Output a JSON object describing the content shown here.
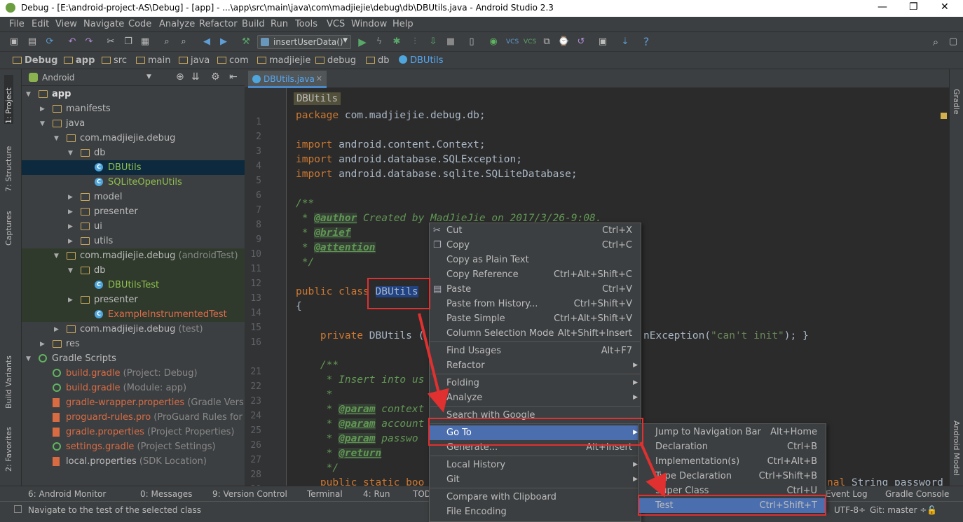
{
  "title": "Debug - [E:\\android-project-AS\\Debug] - [app] - ...\\app\\src\\main\\java\\com\\madjiejie\\debug\\db\\DBUtils.java - Android Studio 2.3",
  "menu": [
    "File",
    "Edit",
    "View",
    "Navigate",
    "Code",
    "Analyze",
    "Refactor",
    "Build",
    "Run",
    "Tools",
    "VCS",
    "Window",
    "Help"
  ],
  "run_config": "insertUserData()",
  "breadcrumb": [
    "Debug",
    "app",
    "src",
    "main",
    "java",
    "com",
    "madjiejie",
    "debug",
    "db",
    "DBUtils"
  ],
  "project_view": "Android",
  "left_tabs": [
    "1: Project",
    "7: Structure",
    "Captures",
    "Build Variants",
    "2: Favorites"
  ],
  "right_tabs": [
    "Gradle",
    "Android Model"
  ],
  "tree": [
    {
      "label": "app",
      "extra": ""
    },
    {
      "label": "manifests",
      "extra": ""
    },
    {
      "label": "java",
      "extra": ""
    },
    {
      "label": "com.madjiejie.debug",
      "extra": ""
    },
    {
      "label": "db",
      "extra": ""
    },
    {
      "label": "DBUtils",
      "extra": ""
    },
    {
      "label": "SQLiteOpenUtils",
      "extra": ""
    },
    {
      "label": "model",
      "extra": ""
    },
    {
      "label": "presenter",
      "extra": ""
    },
    {
      "label": "ui",
      "extra": ""
    },
    {
      "label": "utils",
      "extra": ""
    },
    {
      "label": "com.madjiejie.debug",
      "extra": "(androidTest)"
    },
    {
      "label": "db",
      "extra": ""
    },
    {
      "label": "DBUtilsTest",
      "extra": ""
    },
    {
      "label": "presenter",
      "extra": ""
    },
    {
      "label": "ExampleInstrumentedTest",
      "extra": ""
    },
    {
      "label": "com.madjiejie.debug",
      "extra": "(test)"
    },
    {
      "label": "res",
      "extra": ""
    },
    {
      "label": "Gradle Scripts",
      "extra": ""
    },
    {
      "label": "build.gradle",
      "extra": "(Project: Debug)"
    },
    {
      "label": "build.gradle",
      "extra": "(Module: app)"
    },
    {
      "label": "gradle-wrapper.properties",
      "extra": "(Gradle Version)"
    },
    {
      "label": "proguard-rules.pro",
      "extra": "(ProGuard Rules for app"
    },
    {
      "label": "gradle.properties",
      "extra": "(Project Properties)"
    },
    {
      "label": "settings.gradle",
      "extra": "(Project Settings)"
    },
    {
      "label": "local.properties",
      "extra": "(SDK Location)"
    }
  ],
  "editor_tab": "DBUtils.java",
  "editor_crumb": "DBUtils",
  "line_numbers": [
    "1",
    "2",
    "3",
    "4",
    "5",
    "6",
    "7",
    "8",
    "9",
    "10",
    "11",
    "12",
    "13",
    "14",
    "15",
    "16",
    "21",
    "22",
    "23",
    "24",
    "25",
    "26",
    "27",
    "28",
    "29"
  ],
  "code": {
    "l1a": "package ",
    "l1b": "com.madjiejie.debug.db;",
    "l3a": "import ",
    "l3b": "android.content.Context;",
    "l4a": "import ",
    "l4b": "android.database.SQLException;",
    "l5a": "import ",
    "l5b": "android.database.sqlite.SQLiteDatabase;",
    "l7": "/**",
    "l8a": " * ",
    "l8b": "@author",
    "l8c": " Created by MadJieJie on 2017/3/26-9:08.",
    "l9a": " * ",
    "l9b": "@brief",
    "l10a": " * ",
    "l10b": "@attention",
    "l11": " */",
    "l13a": "public class ",
    "l13b": "DBUtils",
    "l14": "{",
    "l16a": "    private ",
    "l16b": "DBUtils (",
    "l16c": "nException(",
    "l16d": "\"can't init\"",
    "l16e": "); }",
    "l21": "    /**",
    "l22": "     * Insert into us",
    "l23": "     *",
    "l24a": "     * ",
    "l24b": "@param",
    "l24c": " context",
    "l25a": "     * ",
    "l25b": "@param",
    "l25c": " account",
    "l26a": "     * ",
    "l26b": "@param",
    "l26c": " passwo",
    "l27a": "     * ",
    "l27b": "@return",
    "l28": "     */",
    "l29a": "    public static boo",
    "l29b": "nal ",
    "l29c": "String password"
  },
  "context_menu": [
    {
      "label": "Cut",
      "shortcut": "Ctrl+X"
    },
    {
      "label": "Copy",
      "shortcut": "Ctrl+C"
    },
    {
      "label": "Copy as Plain Text",
      "shortcut": ""
    },
    {
      "label": "Copy Reference",
      "shortcut": "Ctrl+Alt+Shift+C"
    },
    {
      "label": "Paste",
      "shortcut": "Ctrl+V"
    },
    {
      "label": "Paste from History...",
      "shortcut": "Ctrl+Shift+V"
    },
    {
      "label": "Paste Simple",
      "shortcut": "Ctrl+Alt+Shift+V"
    },
    {
      "label": "Column Selection Mode",
      "shortcut": "Alt+Shift+Insert"
    },
    {
      "label": "Find Usages",
      "shortcut": "Alt+F7"
    },
    {
      "label": "Refactor",
      "shortcut": ""
    },
    {
      "label": "Folding",
      "shortcut": ""
    },
    {
      "label": "Analyze",
      "shortcut": ""
    },
    {
      "label": "Search with Google",
      "shortcut": ""
    },
    {
      "label": "Go To",
      "shortcut": ""
    },
    {
      "label": "Generate...",
      "shortcut": "Alt+Insert"
    },
    {
      "label": "Local History",
      "shortcut": ""
    },
    {
      "label": "Git",
      "shortcut": ""
    },
    {
      "label": "Compare with Clipboard",
      "shortcut": ""
    },
    {
      "label": "File Encoding",
      "shortcut": ""
    }
  ],
  "submenu": [
    {
      "label": "Jump to Navigation Bar",
      "shortcut": "Alt+Home"
    },
    {
      "label": "Declaration",
      "shortcut": "Ctrl+B"
    },
    {
      "label": "Implementation(s)",
      "shortcut": "Ctrl+Alt+B"
    },
    {
      "label": "Type Declaration",
      "shortcut": "Ctrl+Shift+B"
    },
    {
      "label": "Super Class",
      "shortcut": "Ctrl+U"
    },
    {
      "label": "Test",
      "shortcut": "Ctrl+Shift+T"
    }
  ],
  "bottom_tabs": [
    "6: Android Monitor",
    "0: Messages",
    "9: Version Control",
    "Terminal",
    "4: Run",
    "TOD",
    "Event Log",
    "Gradle Console"
  ],
  "status": {
    "message": "Navigate to the test of the selected class",
    "encoding": "UTF-8÷",
    "git": "Git: master ÷"
  },
  "colors": {
    "accent": "#4b6eaf",
    "red": "#e03030"
  }
}
